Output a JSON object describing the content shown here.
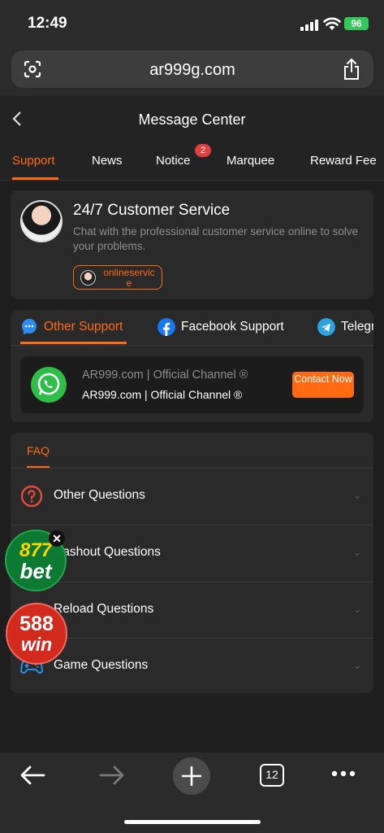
{
  "status": {
    "time": "12:49",
    "battery": "96"
  },
  "browser": {
    "url": "ar999g.com",
    "tab_count": "12"
  },
  "header": {
    "title": "Message Center",
    "back": "<"
  },
  "tabs": [
    {
      "label": "Support",
      "active": true
    },
    {
      "label": "News"
    },
    {
      "label": "Notice",
      "badge": "2"
    },
    {
      "label": "Marquee"
    },
    {
      "label": "Reward Fee"
    }
  ],
  "customer_service": {
    "title": "24/7 Customer Service",
    "description": "Chat with the professional customer service online to solve your problems.",
    "button": "onlineservice"
  },
  "support_tabs": [
    {
      "label": "Other Support",
      "active": true,
      "icon": "chat-bubble-icon"
    },
    {
      "label": "Facebook Support",
      "icon": "facebook-icon"
    },
    {
      "label": "Telegr",
      "icon": "telegram-icon"
    }
  ],
  "channel": {
    "name": "AR999.com | Official Channel ®",
    "subname": "AR999.com | Official Channel ®",
    "contact_label": "Contact Now",
    "icon": "whatsapp-icon"
  },
  "faq": {
    "title": "FAQ",
    "items": [
      {
        "label": "Other Questions",
        "icon": "question-icon"
      },
      {
        "label": "Cashout Questions",
        "icon": "cashout-icon"
      },
      {
        "label": "Reload Questions",
        "icon": "reload-icon"
      },
      {
        "label": "Game Questions",
        "icon": "gamepad-icon"
      }
    ]
  },
  "ads": {
    "ad1_line1": "877",
    "ad1_line2": "bet",
    "ad1_close": "✕",
    "ad2_line1": "588",
    "ad2_line2": "win"
  },
  "colors": {
    "accent": "#ff6a13",
    "background": "#1e1e1e",
    "card": "#2a2a2a"
  }
}
